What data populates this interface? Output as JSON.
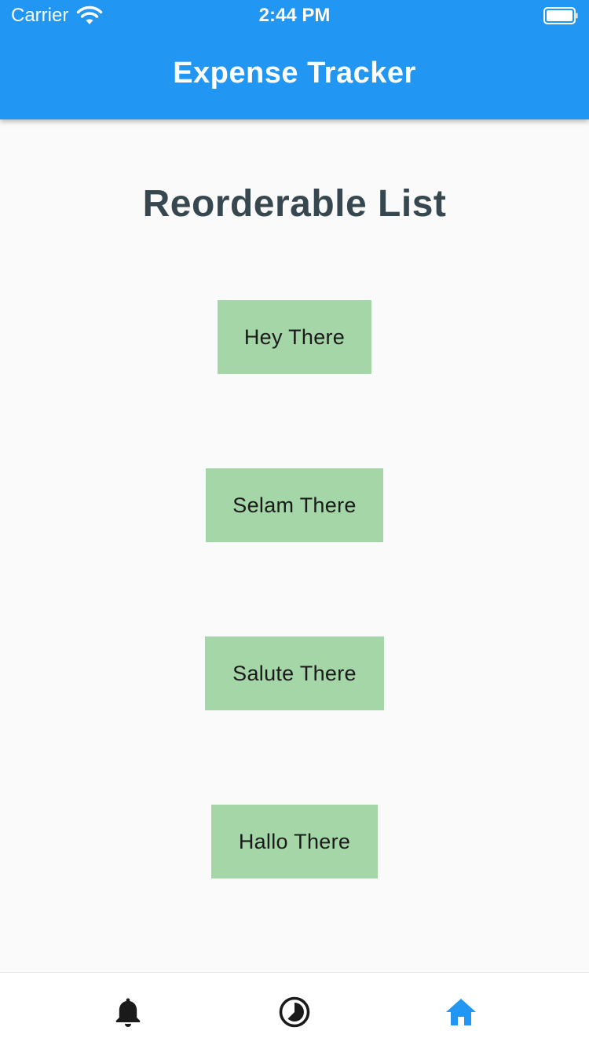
{
  "status_bar": {
    "carrier": "Carrier",
    "time": "2:44 PM"
  },
  "app_bar": {
    "title": "Expense Tracker",
    "color": "#2196f3"
  },
  "main": {
    "heading": "Reorderable List",
    "items": [
      {
        "label": "Hey There"
      },
      {
        "label": "Selam There"
      },
      {
        "label": "Salute There"
      },
      {
        "label": "Hallo There"
      }
    ],
    "item_color": "#a5d6a7"
  },
  "bottom_nav": {
    "items": [
      {
        "icon": "bell-icon",
        "active": false
      },
      {
        "icon": "pie-chart-icon",
        "active": false
      },
      {
        "icon": "home-icon",
        "active": true
      }
    ],
    "active_color": "#2196f3",
    "inactive_color": "#1a1a1a"
  }
}
